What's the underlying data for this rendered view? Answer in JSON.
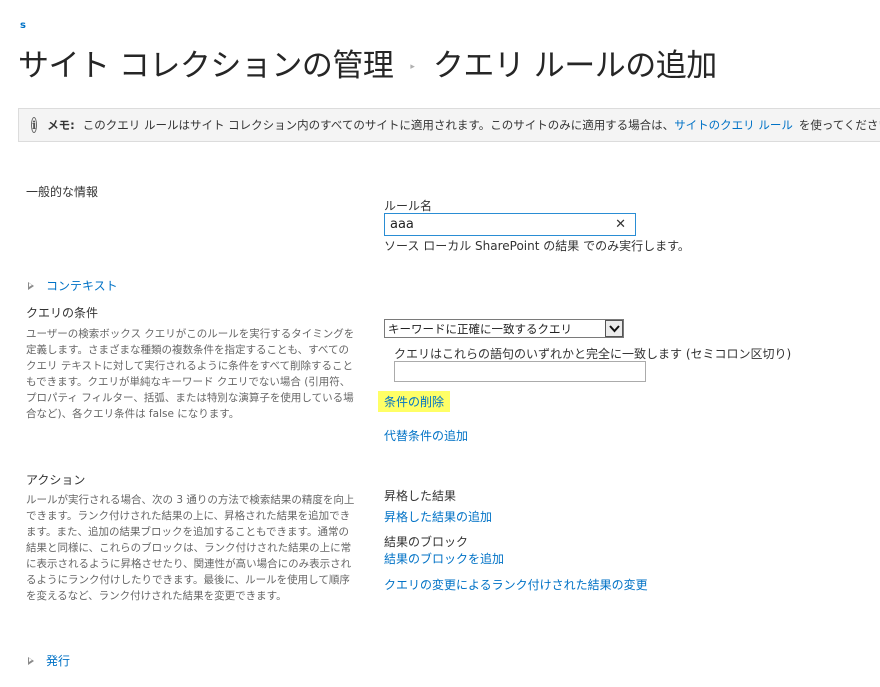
{
  "header": {
    "site_logo": "s",
    "title_part1": "サイト コレクションの管理",
    "separator": "▸",
    "title_part2": "クエリ ルールの追加"
  },
  "note": {
    "label": "メモ:",
    "text": "このクエリ ルールはサイト コレクション内のすべてのサイトに適用されます。このサイトのみに適用する場合は、",
    "link": "サイトのクエリ ルール",
    "suffix": "を使ってください。"
  },
  "general": {
    "title": "一般的な情報",
    "rule_name_label": "ルール名",
    "rule_name_value": "aaa",
    "source_text": "ソース ローカル SharePoint の結果 でのみ実行します。"
  },
  "context": {
    "label": "コンテキスト"
  },
  "query_conditions": {
    "title": "クエリの条件",
    "description": "ユーザーの検索ボックス クエリがこのルールを実行するタイミングを定義します。さまざまな種類の複数条件を指定することも、すべてのクエリ テキストに対して実行されるように条件をすべて削除することもできます。クエリが単純なキーワード クエリでない場合 (引用符、プロパティ フィルター、括弧、または特別な演算子を使用している場合など)、各クエリ条件は false になります。",
    "condition_select": "キーワードに正確に一致するクエリ",
    "terms_label": "クエリはこれらの語句のいずれかと完全に一致します (セミコロン区切り)",
    "terms_value": "",
    "remove_condition": "条件の削除",
    "add_alternate": "代替条件の追加"
  },
  "actions": {
    "title": "アクション",
    "description": "ルールが実行される場合、次の 3 通りの方法で検索結果の精度を向上できます。ランク付けされた結果の上に、昇格された結果を追加できます。また、追加の結果ブロックを追加することもできます。通常の結果と同様に、これらのブロックは、ランク付けされた結果の上に常に表示されるように昇格させたり、関連性が高い場合にのみ表示されるようにランク付けしたりできます。最後に、ルールを使用して順序を変えるなど、ランク付けされた結果を変更できます。",
    "promoted_label": "昇格した結果",
    "promoted_link": "昇格した結果の追加",
    "block_label": "結果のブロック",
    "block_link": "結果のブロックを追加",
    "change_ranked_link": "クエリの変更によるランク付けされた結果の変更"
  },
  "publishing": {
    "label": "発行"
  }
}
